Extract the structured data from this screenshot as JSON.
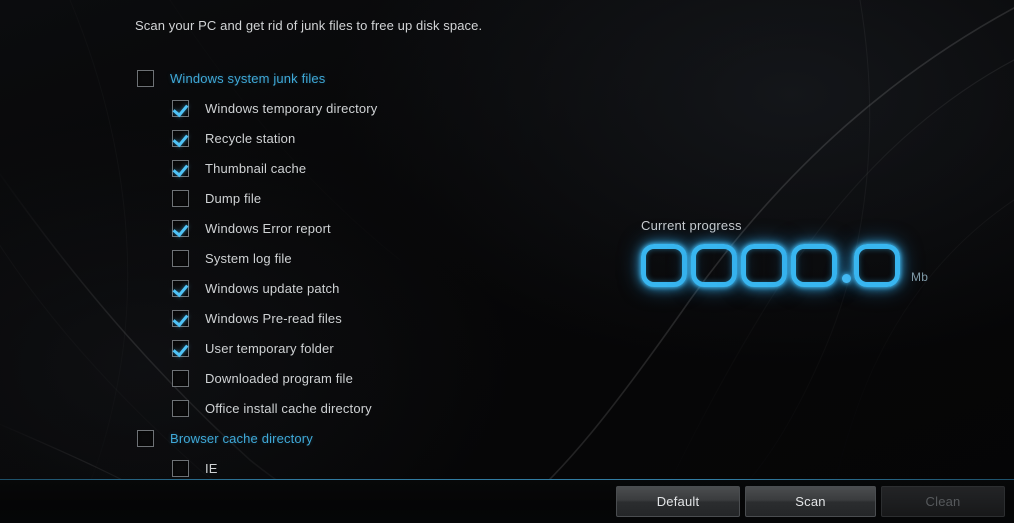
{
  "intro": {
    "text": "Scan your PC and get rid of junk files to free up disk space."
  },
  "tree": [
    {
      "label": "Windows system junk files",
      "level": 0,
      "checked": false
    },
    {
      "label": "Windows temporary directory",
      "level": 1,
      "checked": true
    },
    {
      "label": "Recycle station",
      "level": 1,
      "checked": true
    },
    {
      "label": "Thumbnail cache",
      "level": 1,
      "checked": true
    },
    {
      "label": "Dump file",
      "level": 1,
      "checked": false
    },
    {
      "label": "Windows Error report",
      "level": 1,
      "checked": true
    },
    {
      "label": "System log file",
      "level": 1,
      "checked": false
    },
    {
      "label": "Windows update patch",
      "level": 1,
      "checked": true
    },
    {
      "label": "Windows Pre-read files",
      "level": 1,
      "checked": true
    },
    {
      "label": "User temporary folder",
      "level": 1,
      "checked": true
    },
    {
      "label": "Downloaded program file",
      "level": 1,
      "checked": false
    },
    {
      "label": "Office install cache directory",
      "level": 1,
      "checked": false
    },
    {
      "label": "Browser cache directory",
      "level": 0,
      "checked": false
    },
    {
      "label": "IE",
      "level": 1,
      "checked": false
    }
  ],
  "progress": {
    "label": "Current progress",
    "digits": [
      "0",
      "0",
      "0",
      "0"
    ],
    "decimal": "0",
    "separator": ".",
    "unit": "Mb",
    "value": "0000.0",
    "accent_color": "#38b6f0"
  },
  "footer": {
    "buttons": [
      {
        "label": "Default",
        "disabled": false
      },
      {
        "label": "Scan",
        "disabled": false
      },
      {
        "label": "Clean",
        "disabled": true
      }
    ],
    "separator_color": "#1d4c63"
  }
}
